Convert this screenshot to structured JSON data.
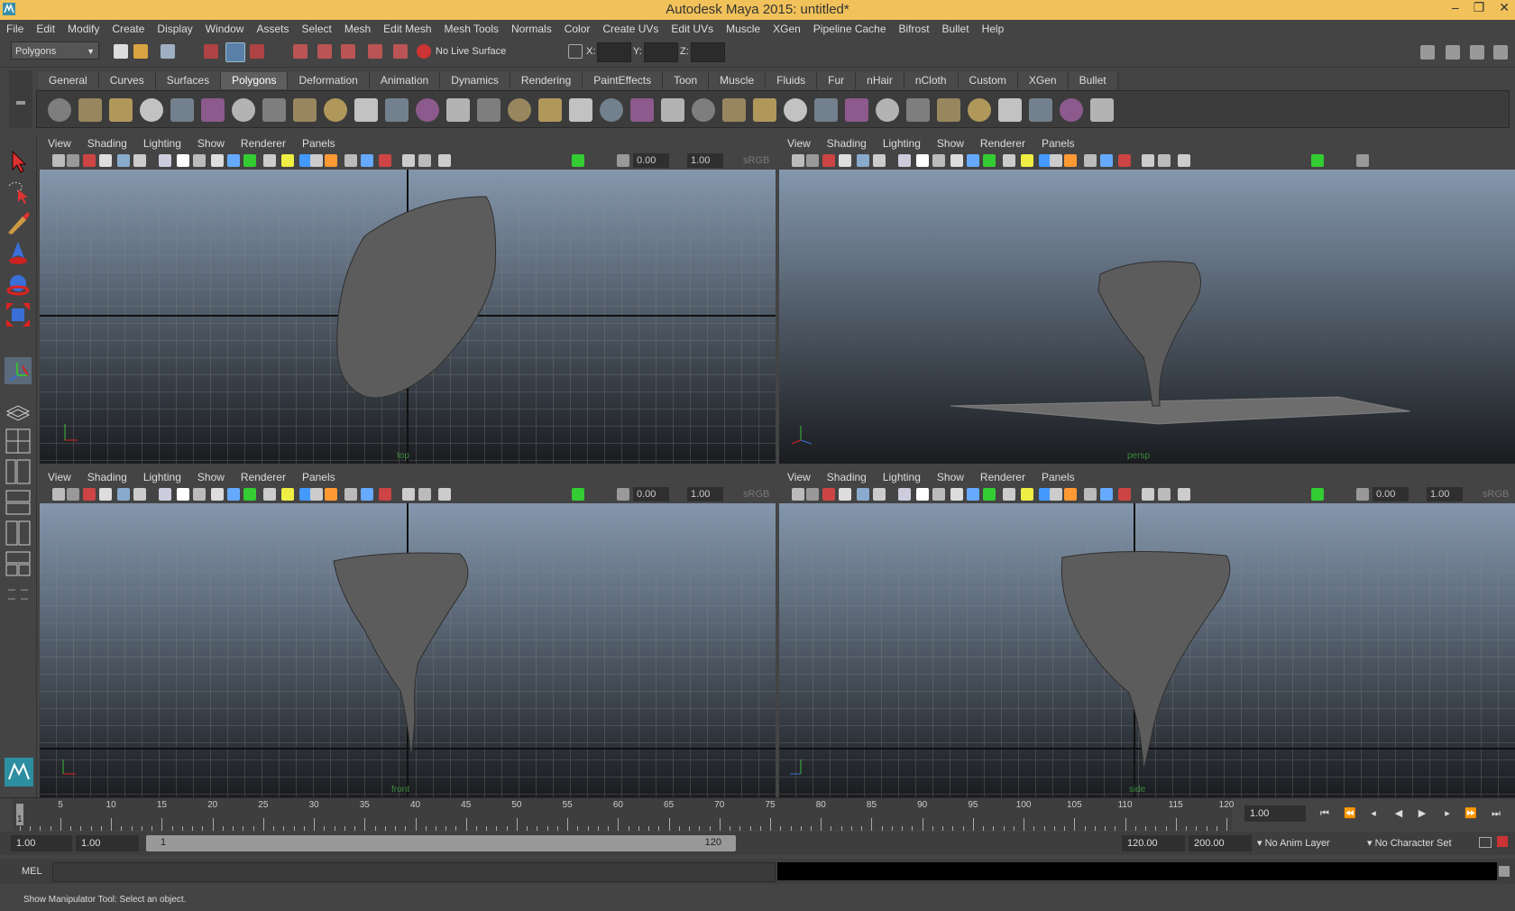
{
  "window": {
    "title": "Autodesk Maya 2015: untitled*",
    "buttons": [
      "–",
      "❐",
      "✕"
    ]
  },
  "menubar": [
    "File",
    "Edit",
    "Modify",
    "Create",
    "Display",
    "Window",
    "Assets",
    "Select",
    "Mesh",
    "Edit Mesh",
    "Mesh Tools",
    "Normals",
    "Color",
    "Create UVs",
    "Edit UVs",
    "Muscle",
    "XGen",
    "Pipeline Cache",
    "Bifrost",
    "Bullet",
    "Help"
  ],
  "statusline": {
    "menu_set": "Polygons",
    "live_surface": "No Live Surface",
    "x_label": "X:",
    "y_label": "Y:",
    "z_label": "Z:"
  },
  "shelf_tabs": [
    "General",
    "Curves",
    "Surfaces",
    "Polygons",
    "Deformation",
    "Animation",
    "Dynamics",
    "Rendering",
    "PaintEffects",
    "Toon",
    "Muscle",
    "Fluids",
    "Fur",
    "nHair",
    "nCloth",
    "Custom",
    "XGen",
    "Bullet"
  ],
  "shelf_active": "Polygons",
  "viewport_menu": [
    "View",
    "Shading",
    "Lighting",
    "Show",
    "Renderer",
    "Panels"
  ],
  "viewport_fields": {
    "exposure": "0.00",
    "gamma": "1.00",
    "color_space": "sRGB g"
  },
  "viewports": [
    {
      "id": "top",
      "camera": "top"
    },
    {
      "id": "persp",
      "camera": "persp"
    },
    {
      "id": "front",
      "camera": "front"
    },
    {
      "id": "side",
      "camera": "side"
    }
  ],
  "timeslider": {
    "ticks": [
      "5",
      "10",
      "15",
      "20",
      "25",
      "30",
      "35",
      "40",
      "45",
      "50",
      "55",
      "60",
      "65",
      "70",
      "75",
      "80",
      "85",
      "90",
      "95",
      "100",
      "105",
      "110",
      "115",
      "120"
    ],
    "current_frame": "1",
    "current_time_field": "1.00"
  },
  "rangeslider": {
    "start_time": "1.00",
    "playback_start": "1.00",
    "range_start": "1",
    "range_end": "120",
    "playback_end": "120.00",
    "end_time": "200.00",
    "anim_layer": "No Anim Layer",
    "character_set": "No Character Set"
  },
  "cmdline": {
    "label": "MEL"
  },
  "helpline": {
    "text": "Show Manipulator Tool: Select an object."
  },
  "colors": {
    "title_bar": "#f1c25a",
    "ui_bg": "#444444",
    "viewport_top": "#8497ad",
    "viewport_bottom": "#1a1c1f",
    "grid": "#8c8c8c",
    "model": "#5c5c5c"
  }
}
